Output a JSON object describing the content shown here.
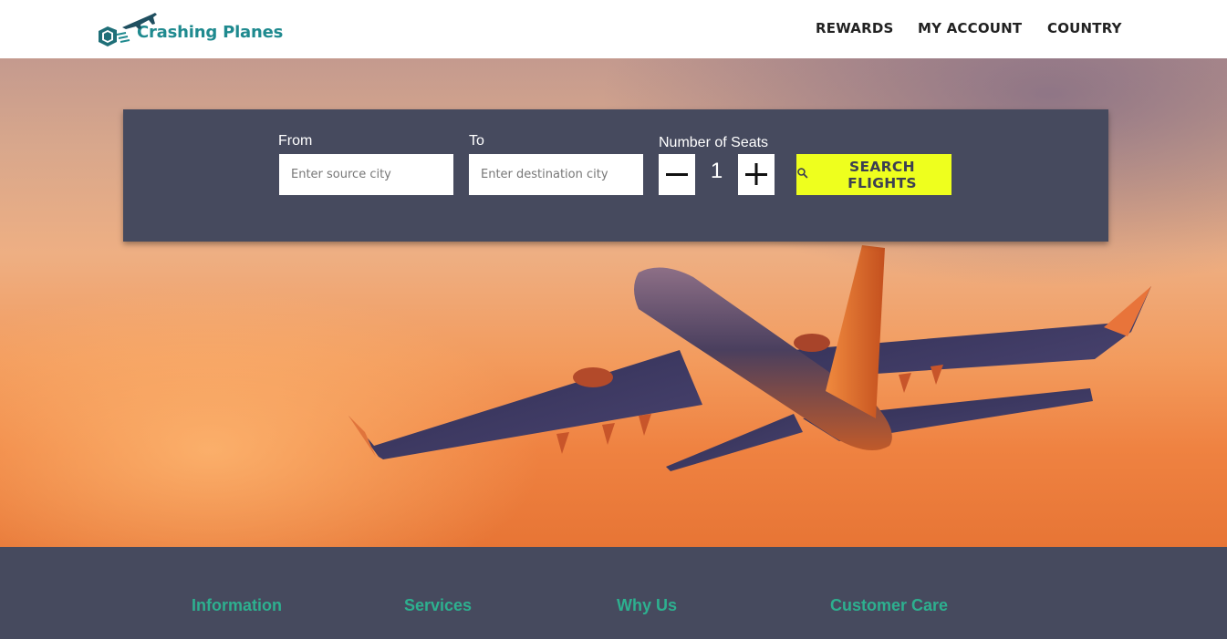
{
  "header": {
    "logo_text": "Crashing Planes",
    "logo_icon": "plane-box-logo-icon",
    "nav": {
      "rewards": "REWARDS",
      "my_account": "MY ACCOUNT",
      "country": "COUNTRY"
    }
  },
  "search": {
    "from_label": "From",
    "from_placeholder": "Enter source city",
    "to_label": "To",
    "to_placeholder": "Enter destination city",
    "seats_label": "Number of Seats",
    "seats_value": "1",
    "decrement_icon": "minus-icon",
    "increment_icon": "plus-icon",
    "search_icon": "search-icon",
    "search_button": "SEARCH FLIGHTS"
  },
  "footer": {
    "headings": {
      "information": "Information",
      "services": "Services",
      "why_us": "Why Us",
      "customer_care": "Customer Care"
    }
  },
  "colors": {
    "panel": "#464a5e",
    "search_button": "#eeff1e",
    "footer_heading": "#2db08f",
    "brand": "#1f8a8f"
  }
}
